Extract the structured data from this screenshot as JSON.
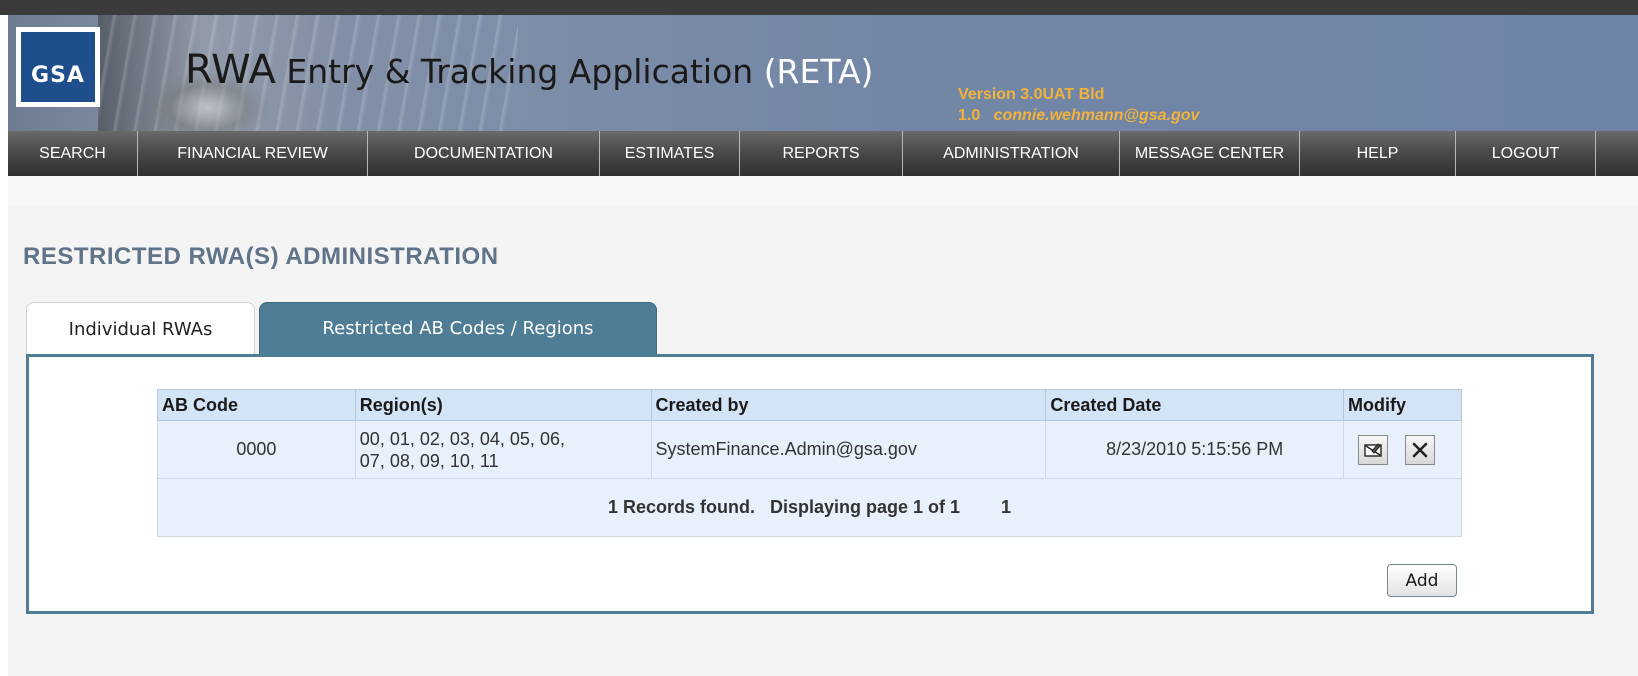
{
  "header": {
    "logo_text": "GSA",
    "title_rwa": "RWA",
    "title_rest": "Entry & Tracking Application",
    "title_reta": "(RETA)",
    "version_line1": "Version 3.0UAT Bld",
    "version_line2_build": "1.0",
    "user_email": "connie.wehmann@gsa.gov"
  },
  "nav": {
    "items": [
      "SEARCH",
      "FINANCIAL REVIEW",
      "DOCUMENTATION",
      "ESTIMATES",
      "REPORTS",
      "ADMINISTRATION",
      "MESSAGE CENTER",
      "HELP",
      "LOGOUT"
    ]
  },
  "page": {
    "title": "RESTRICTED RWA(S) ADMINISTRATION"
  },
  "tabs": [
    {
      "label": "Individual RWAs",
      "active": false
    },
    {
      "label": "Restricted AB Codes / Regions",
      "active": true
    }
  ],
  "table": {
    "columns": [
      "AB Code",
      "Region(s)",
      "Created by",
      "Created Date",
      "Modify"
    ],
    "rows": [
      {
        "ab_code": "0000",
        "regions_line1": "00, 01, 02, 03, 04, 05, 06,",
        "regions_line2": "07, 08, 09, 10, 11",
        "created_by": "SystemFinance.Admin@gsa.gov",
        "created_date": "8/23/2010 5:15:56 PM"
      }
    ],
    "pager_text": "1 Records found.   Displaying page 1 of 1",
    "pager_page": "1"
  },
  "actions": {
    "add_label": "Add"
  },
  "colors": {
    "tab_active": "#4f7d95",
    "header_row": "#d4e4f7",
    "pager_bg": "#6a7f9a",
    "title_color": "#5f7389",
    "version_color": "#f3b23a"
  }
}
